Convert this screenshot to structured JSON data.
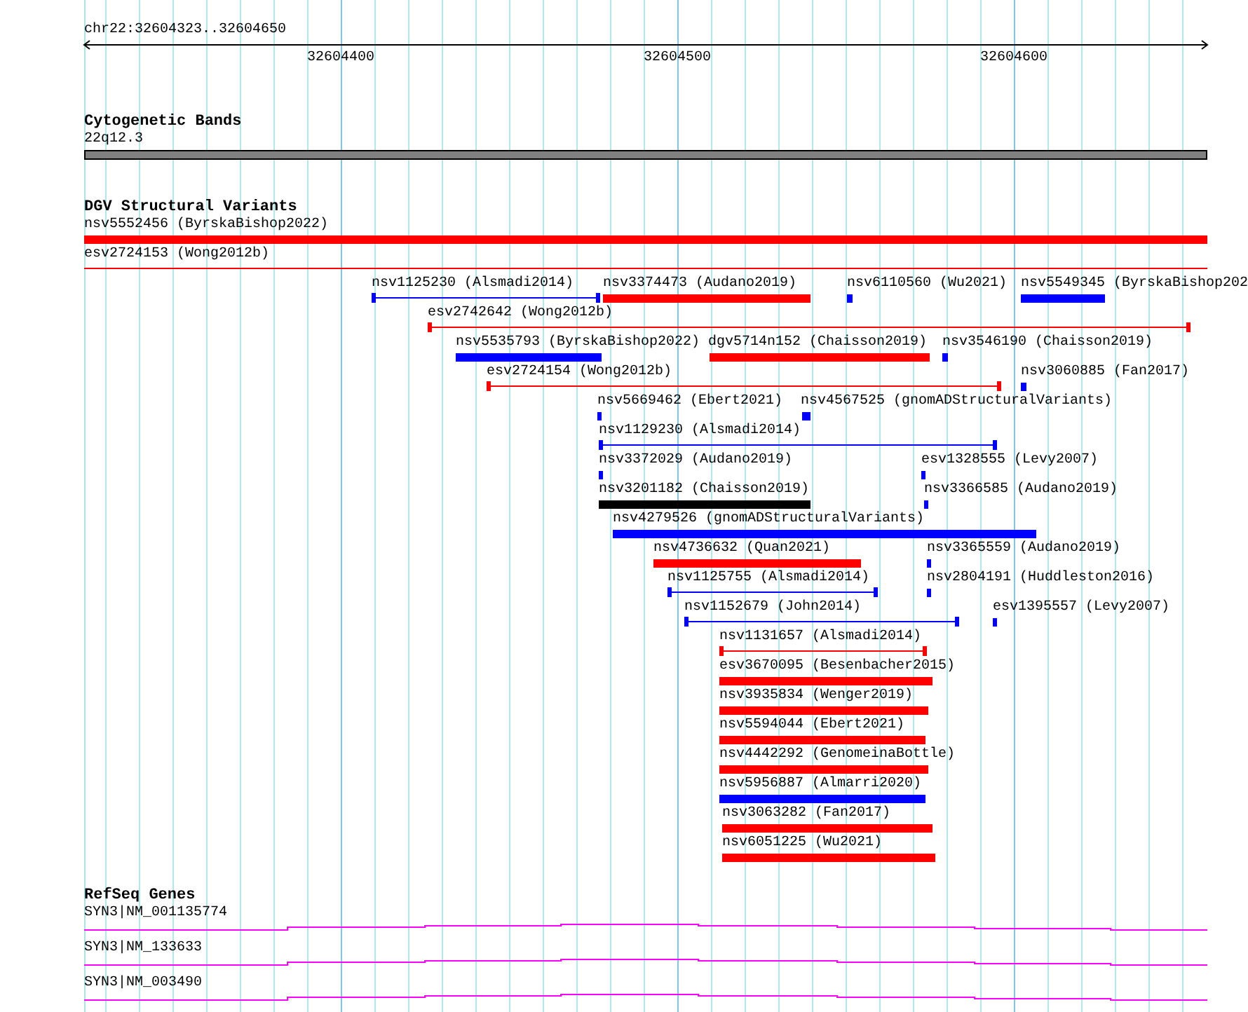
{
  "ruler": {
    "location": "chr22:32604323..32604650",
    "ticks": [
      "32604400",
      "32604500",
      "32604600"
    ]
  },
  "cytoband": {
    "title": "Cytogenetic Bands",
    "band": "22q12.3"
  },
  "dgv": {
    "title": "DGV Structural Variants",
    "variants": [
      {
        "label": "nsv5552456 (ByrskaBishop2022)",
        "color": "#ff0000",
        "kind": "bar"
      },
      {
        "label": "esv2724153 (Wong2012b)",
        "color": "#ff0000",
        "kind": "line"
      },
      {
        "label": "nsv1125230 (Alsmadi2014)",
        "color": "#0000ff",
        "kind": "line"
      },
      {
        "label": "nsv3374473 (Audano2019)",
        "color": "#ff0000",
        "kind": "bar"
      },
      {
        "label": "nsv6110560 (Wu2021)",
        "color": "#0000ff",
        "kind": "bar"
      },
      {
        "label": "nsv5549345 (ByrskaBishop202",
        "color": "#0000ff",
        "kind": "bar"
      },
      {
        "label": "esv2742642 (Wong2012b)",
        "color": "#ff0000",
        "kind": "line"
      },
      {
        "label": "nsv5535793 (ByrskaBishop2022)",
        "color": "#0000ff",
        "kind": "bar"
      },
      {
        "label": "dgv5714n152 (Chaisson2019)",
        "color": "#ff0000",
        "kind": "bar"
      },
      {
        "label": "nsv3546190 (Chaisson2019)",
        "color": "#0000ff",
        "kind": "bar"
      },
      {
        "label": "esv2724154 (Wong2012b)",
        "color": "#ff0000",
        "kind": "line"
      },
      {
        "label": "nsv3060885 (Fan2017)",
        "color": "#0000ff",
        "kind": "bar"
      },
      {
        "label": "nsv5669462 (Ebert2021)",
        "color": "#0000ff",
        "kind": "bar"
      },
      {
        "label": "nsv4567525 (gnomADStructuralVariants)",
        "color": "#0000ff",
        "kind": "bar"
      },
      {
        "label": "nsv1129230 (Alsmadi2014)",
        "color": "#0000ff",
        "kind": "line"
      },
      {
        "label": "nsv3372029 (Audano2019)",
        "color": "#0000ff",
        "kind": "bar"
      },
      {
        "label": "esv1328555 (Levy2007)",
        "color": "#0000ff",
        "kind": "bar"
      },
      {
        "label": "nsv3201182 (Chaisson2019)",
        "color": "#000000",
        "kind": "bar"
      },
      {
        "label": "nsv3366585 (Audano2019)",
        "color": "#0000ff",
        "kind": "bar"
      },
      {
        "label": "nsv4279526 (gnomADStructuralVariants)",
        "color": "#0000ff",
        "kind": "bar"
      },
      {
        "label": "nsv4736632 (Quan2021)",
        "color": "#ff0000",
        "kind": "bar"
      },
      {
        "label": "nsv3365559 (Audano2019)",
        "color": "#0000ff",
        "kind": "bar"
      },
      {
        "label": "nsv1125755 (Alsmadi2014)",
        "color": "#0000ff",
        "kind": "line"
      },
      {
        "label": "nsv2804191 (Huddleston2016)",
        "color": "#0000ff",
        "kind": "bar"
      },
      {
        "label": "nsv1152679 (John2014)",
        "color": "#0000ff",
        "kind": "line"
      },
      {
        "label": "esv1395557 (Levy2007)",
        "color": "#0000ff",
        "kind": "bar"
      },
      {
        "label": "nsv1131657 (Alsmadi2014)",
        "color": "#ff0000",
        "kind": "line"
      },
      {
        "label": "esv3670095 (Besenbacher2015)",
        "color": "#ff0000",
        "kind": "bar"
      },
      {
        "label": "nsv3935834 (Wenger2019)",
        "color": "#ff0000",
        "kind": "bar"
      },
      {
        "label": "nsv5594044 (Ebert2021)",
        "color": "#ff0000",
        "kind": "bar"
      },
      {
        "label": "nsv4442292 (GenomeinaBottle)",
        "color": "#ff0000",
        "kind": "bar"
      },
      {
        "label": "nsv5956887 (Almarri2020)",
        "color": "#0000ff",
        "kind": "bar"
      },
      {
        "label": "nsv3063282 (Fan2017)",
        "color": "#ff0000",
        "kind": "bar"
      },
      {
        "label": "nsv6051225 (Wu2021)",
        "color": "#ff0000",
        "kind": "bar"
      }
    ]
  },
  "refseq": {
    "title": "RefSeq Genes",
    "genes": [
      {
        "label": "SYN3|NM_001135774"
      },
      {
        "label": "SYN3|NM_133633"
      },
      {
        "label": "SYN3|NM_003490"
      }
    ]
  }
}
